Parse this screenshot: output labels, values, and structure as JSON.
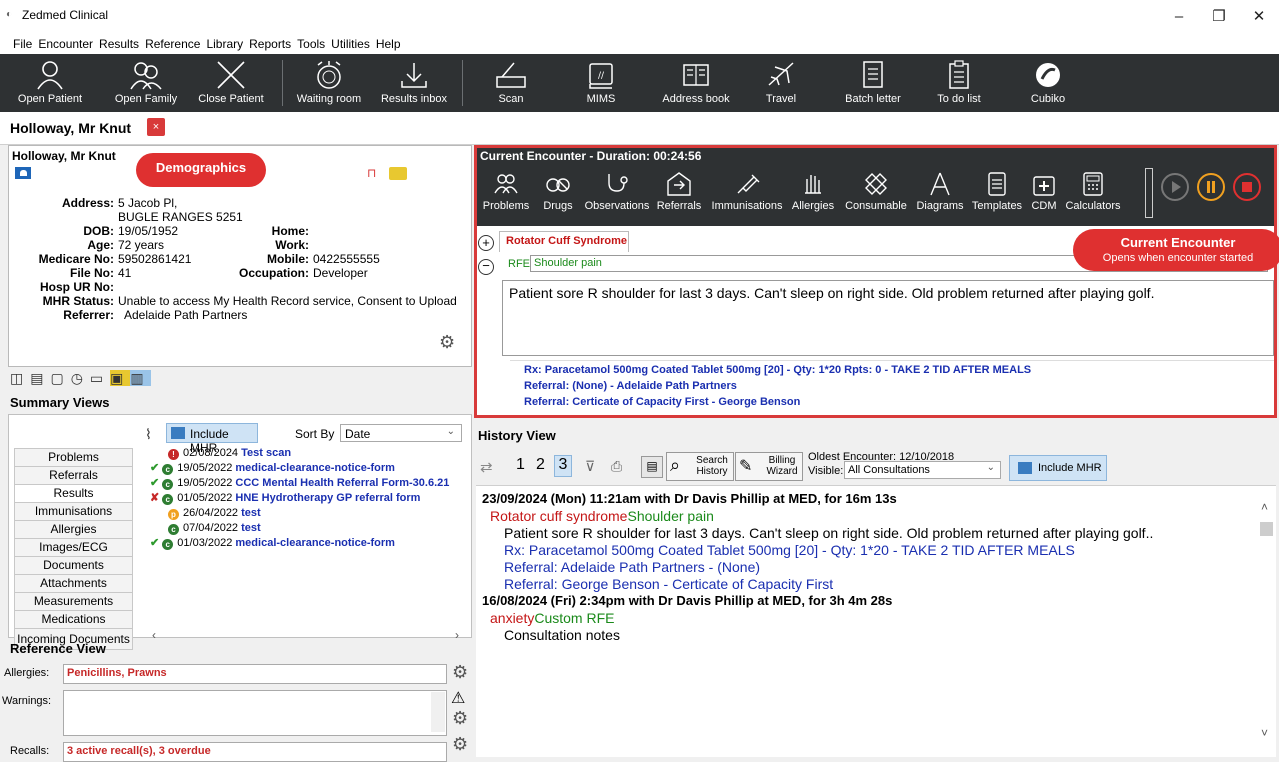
{
  "window": {
    "title": "Zedmed Clinical",
    "min": "–",
    "restore": "❐",
    "close": "✕"
  },
  "menu": [
    "File",
    "Encounter",
    "Results",
    "Reference",
    "Library",
    "Reports",
    "Tools",
    "Utilities",
    "Help"
  ],
  "toolbar": {
    "open_patient": "Open Patient",
    "open_family": "Open Family",
    "close_patient": "Close Patient",
    "waiting_room": "Waiting room",
    "results_inbox": "Results inbox",
    "scan": "Scan",
    "mims": "MIMS",
    "address_book": "Address book",
    "travel": "Travel",
    "batch_letter": "Batch letter",
    "to_do_list": "To do list",
    "cubiko": "Cubiko"
  },
  "patient_tab": {
    "name": "Holloway, Mr Knut",
    "close": "×"
  },
  "demographics": {
    "name": "Holloway, Mr Knut",
    "callout": "Demographics",
    "address_label": "Address:",
    "address_line1": "5 Jacob Pl,",
    "address_line2": "BUGLE RANGES  5251",
    "dob_label": "DOB:",
    "dob": "19/05/1952",
    "age_label": "Age:",
    "age": "72 years",
    "medicare_label": "Medicare No:",
    "medicare": "59502861421",
    "file_label": "File No:",
    "file": "41",
    "hosp_label": "Hosp UR No:",
    "mhr_label": "MHR Status:",
    "mhr": "Unable to access My Health Record service, Consent to Upload",
    "referrer_label": "Referrer:",
    "referrer": "Adelaide Path Partners",
    "home_label": "Home:",
    "work_label": "Work:",
    "mobile_label": "Mobile:",
    "mobile": "0422555555",
    "occupation_label": "Occupation:",
    "occupation": "Developer"
  },
  "summary": {
    "title": "Summary Views",
    "tabs": [
      "Problems",
      "Referrals",
      "Results",
      "Immunisations",
      "Allergies",
      "Images/ECG",
      "Documents",
      "Attachments",
      "Measurements",
      "Medications",
      "Incoming Documents"
    ],
    "include_mhr": "Include MHR",
    "sort_by_label": "Sort By",
    "sort_by_value": "Date",
    "items": [
      {
        "mark": "",
        "icon": "alert",
        "date": "02/08/2024",
        "title": "Test scan"
      },
      {
        "mark": "✔",
        "icon": "check",
        "date": "19/05/2022",
        "title": "medical-clearance-notice-form"
      },
      {
        "mark": "✔",
        "icon": "check",
        "date": "19/05/2022",
        "title": "CCC Mental Health Referral Form-30.6.21"
      },
      {
        "mark": "✘",
        "icon": "check",
        "date": "01/05/2022",
        "title": "HNE Hydrotherapy GP referral form"
      },
      {
        "mark": "",
        "icon": "pending",
        "date": "26/04/2022",
        "title": "test"
      },
      {
        "mark": "",
        "icon": "check",
        "date": "07/04/2022",
        "title": "test"
      },
      {
        "mark": "✔",
        "icon": "check",
        "date": "01/03/2022",
        "title": "medical-clearance-notice-form"
      }
    ]
  },
  "reference": {
    "title": "Reference View",
    "allergies_label": "Allergies:",
    "allergies": "Penicillins, Prawns",
    "warnings_label": "Warnings:",
    "recalls_label": "Recalls:",
    "recalls": "3 active recall(s), 3 overdue"
  },
  "encounter": {
    "header": "Current Encounter - Duration: 00:24:56",
    "tools": [
      "Problems",
      "Drugs",
      "Observations",
      "Referrals",
      "Immunisations",
      "Allergies",
      "Consumable",
      "Diagrams",
      "Templates",
      "CDM",
      "Calculators"
    ],
    "problem_tab": "Rotator Cuff Syndrome",
    "rfe_label": "RFE:",
    "rfe_value": "Shoulder pain",
    "note": "Patient sore R shoulder for last 3 days. Can't sleep on right side. Old problem returned after playing golf.",
    "rx": "Rx: Paracetamol 500mg Coated Tablet 500mg [20] - Qty: 1*20 Rpts: 0 - TAKE 2 TID AFTER MEALS",
    "referral1": "Referral: (None) - Adelaide Path Partners",
    "referral2": "Referral: Certicate of Capacity First - George Benson",
    "callout_title": "Current Encounter",
    "callout_sub": "Opens when encounter started"
  },
  "history": {
    "title": "History View",
    "pages": [
      "1",
      "2",
      "3"
    ],
    "search_btn": "Search History",
    "billing_btn": "Billing Wizard",
    "oldest_label": "Oldest Encounter: 12/10/2018",
    "visible_label": "Visible:",
    "visible_value": "All Consultations",
    "include_mhr": "Include MHR",
    "entries": [
      {
        "header": "23/09/2024 (Mon) 11:21am with Dr Davis Phillip at MED, for 16m 13s",
        "problem": "Rotator cuff syndrome",
        "rfe": "Shoulder pain",
        "note": "Patient sore R shoulder for last 3 days. Can't sleep on right side. Old problem returned after playing golf..",
        "rx": "Rx: Paracetamol 500mg Coated Tablet 500mg [20] - Qty: 1*20 - TAKE 2 TID AFTER MEALS",
        "ref1": "Referral: Adelaide Path Partners - (None)",
        "ref2": "Referral: George Benson - Certicate of Capacity First"
      },
      {
        "header": "16/08/2024 (Fri) 2:34pm with Dr Davis Phillip at MED, for 3h 4m 28s",
        "problem": "anxiety",
        "rfe": "Custom RFE",
        "note": "Consultation notes"
      }
    ]
  },
  "colors": {
    "accent_red": "#df3030",
    "toolbar_dark": "#2e3133",
    "link_blue": "#1a2fb0",
    "problem_red": "#c41616",
    "rfe_green": "#1b8a1b"
  }
}
